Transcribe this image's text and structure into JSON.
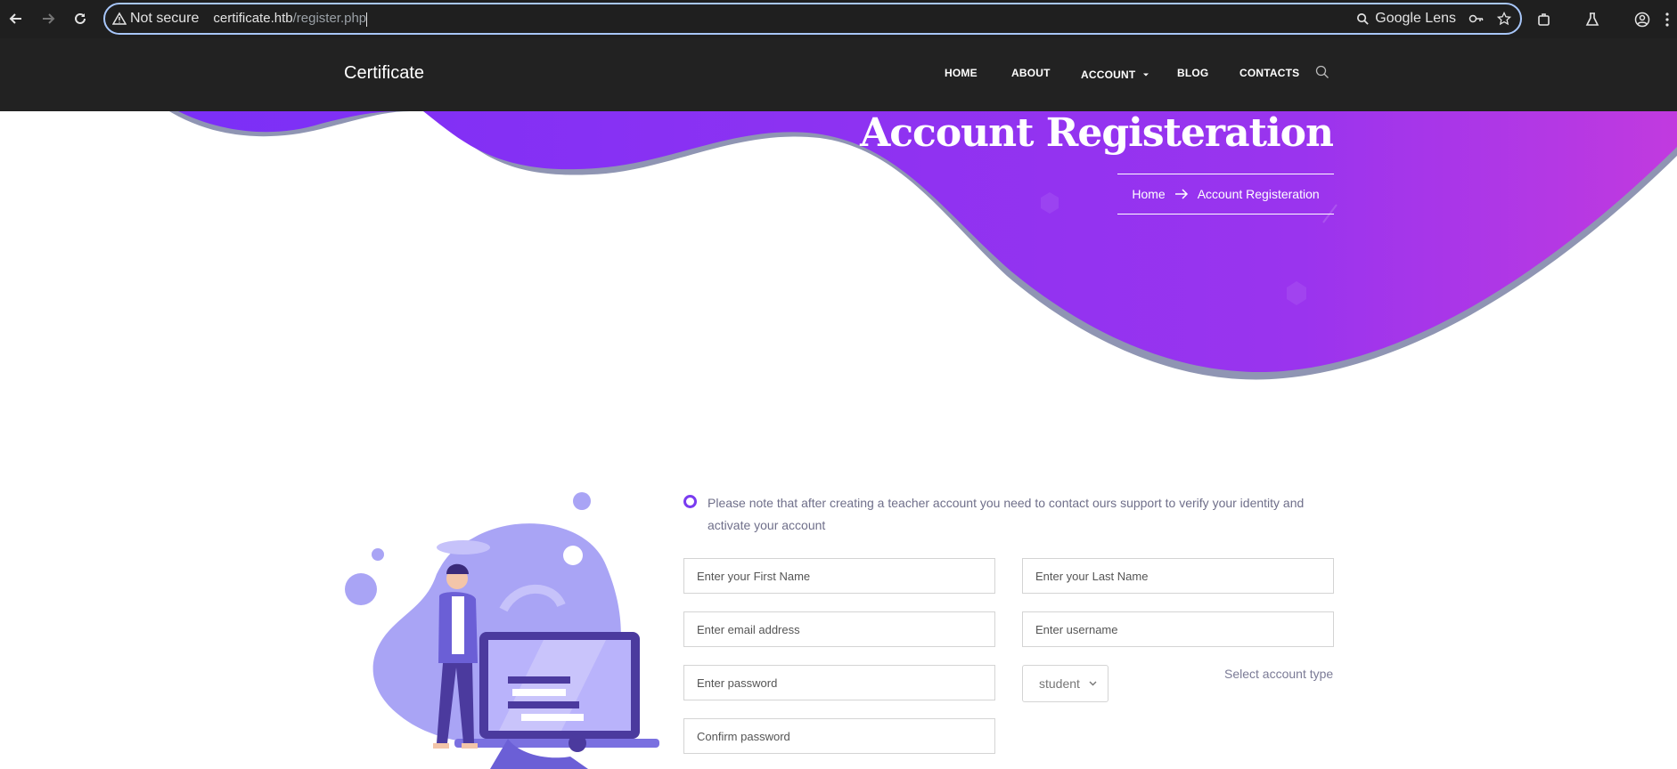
{
  "browser": {
    "security_label": "Not secure",
    "url_host": "certificate.htb",
    "url_path": "/register.php",
    "lens_label": "Google Lens"
  },
  "site": {
    "brand": "Certificate",
    "nav": [
      "HOME",
      "ABOUT",
      "ACCOUNT",
      "BLOG",
      "CONTACTS"
    ]
  },
  "hero": {
    "title": "Account Registeration",
    "breadcrumb_home": "Home",
    "breadcrumb_current": "Account Registeration"
  },
  "form": {
    "note": "Please note that after creating a teacher account you need to contact ours support to verify your identity and activate your account",
    "first_name_placeholder": "Enter your First Name",
    "last_name_placeholder": "Enter your Last Name",
    "email_placeholder": "Enter email address",
    "username_placeholder": "Enter username",
    "password_placeholder": "Enter password",
    "confirm_password_placeholder": "Confirm password",
    "account_type_value": "student",
    "account_type_label": "Select account type"
  },
  "colors": {
    "accent": "#7a3cf0",
    "hero_gradient_start": "#7b2ff7",
    "hero_gradient_end": "#c13adf",
    "header_bg": "#222222"
  }
}
